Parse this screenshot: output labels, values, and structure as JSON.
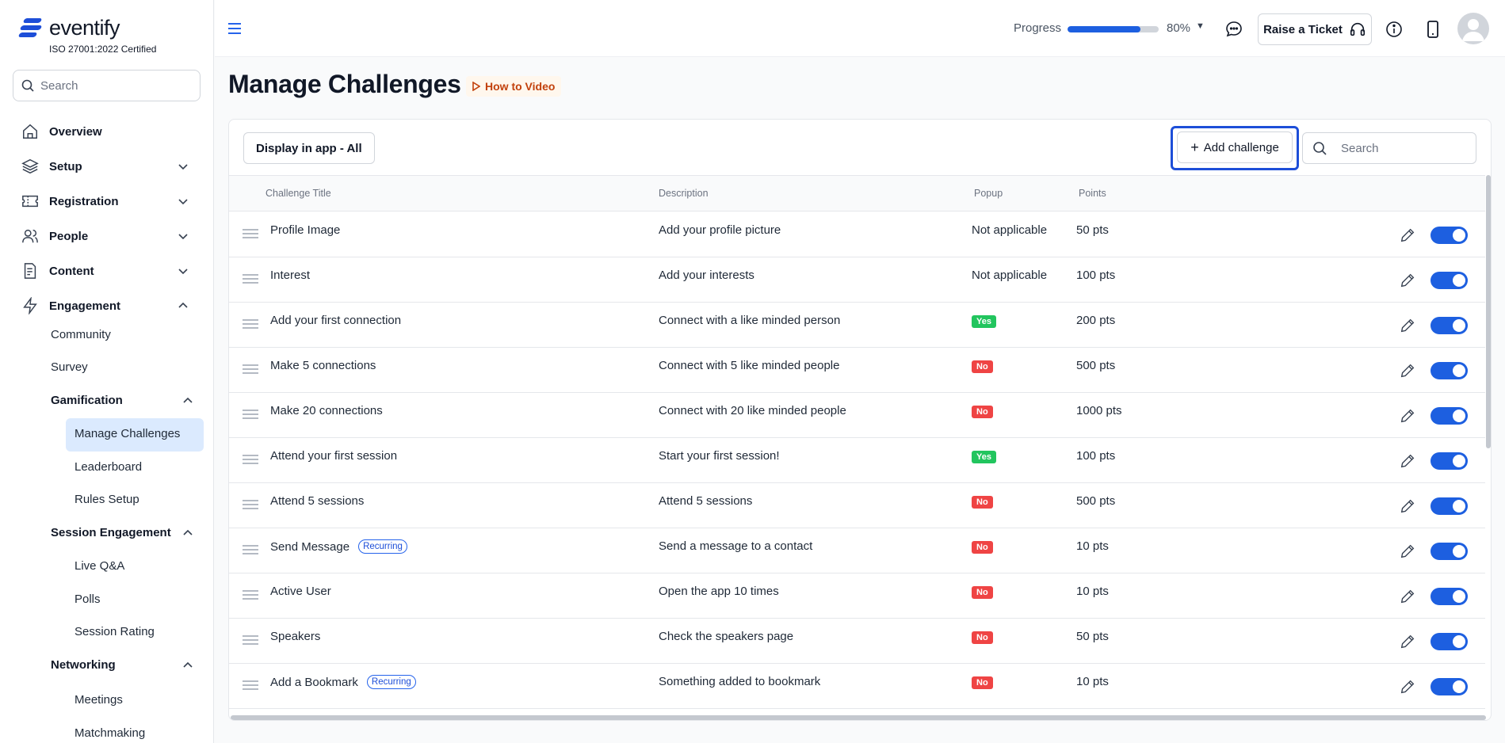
{
  "sidebar": {
    "brand": "eventify",
    "certification": "ISO 27001:2022 Certified",
    "search_placeholder": "Search",
    "nav": [
      {
        "label": "Overview"
      },
      {
        "label": "Setup"
      },
      {
        "label": "Registration"
      },
      {
        "label": "People"
      },
      {
        "label": "Content"
      },
      {
        "label": "Engagement"
      }
    ],
    "engagement_items": [
      "Community",
      "Survey"
    ],
    "gamification": {
      "label": "Gamification",
      "items": [
        "Manage Challenges",
        "Leaderboard",
        "Rules Setup"
      ]
    },
    "session_engagement": {
      "label": "Session Engagement",
      "items": [
        "Live Q&A",
        "Polls",
        "Session Rating"
      ]
    },
    "networking": {
      "label": "Networking",
      "items": [
        "Meetings",
        "Matchmaking"
      ]
    }
  },
  "topbar": {
    "progress_label": "Progress",
    "progress_value": 0.8,
    "progress_pct": "80%",
    "ticket_label": "Raise a Ticket"
  },
  "page": {
    "title": "Manage Challenges",
    "how_to": "How to Video"
  },
  "toolbar": {
    "filter_label": "Display in app - All",
    "add_label": "Add challenge",
    "search_placeholder": "Search"
  },
  "table": {
    "columns": [
      "Challenge Title",
      "Description",
      "Popup",
      "Points"
    ],
    "rows": [
      {
        "title": "Profile Image",
        "recurring": "",
        "description": "Add your profile picture",
        "popup": "Not applicable",
        "points": "50 pts",
        "enabled": true
      },
      {
        "title": "Interest",
        "recurring": "",
        "description": "Add your interests",
        "popup": "Not applicable",
        "points": "100 pts",
        "enabled": true
      },
      {
        "title": "Add your first connection",
        "recurring": "",
        "description": "Connect with a like minded person",
        "popup": "Yes",
        "points": "200 pts",
        "enabled": true
      },
      {
        "title": "Make 5 connections",
        "recurring": "",
        "description": "Connect with 5 like minded people",
        "popup": "No",
        "points": "500 pts",
        "enabled": true
      },
      {
        "title": "Make 20 connections",
        "recurring": "",
        "description": "Connect with 20 like minded people",
        "popup": "No",
        "points": "1000 pts",
        "enabled": true
      },
      {
        "title": "Attend your first session",
        "recurring": "",
        "description": "Start your first session!",
        "popup": "Yes",
        "points": "100 pts",
        "enabled": true
      },
      {
        "title": "Attend 5 sessions",
        "recurring": "",
        "description": "Attend 5 sessions",
        "popup": "No",
        "points": "500 pts",
        "enabled": true
      },
      {
        "title": "Send Message",
        "recurring": "Recurring",
        "description": "Send a message to a contact",
        "popup": "No",
        "points": "10 pts",
        "enabled": true
      },
      {
        "title": "Active User",
        "recurring": "",
        "description": "Open the app 10 times",
        "popup": "No",
        "points": "10 pts",
        "enabled": true
      },
      {
        "title": "Speakers",
        "recurring": "",
        "description": "Check the speakers page",
        "popup": "No",
        "points": "50 pts",
        "enabled": true
      },
      {
        "title": "Add a Bookmark",
        "recurring": "Recurring",
        "description": "Something added to bookmark",
        "popup": "No",
        "points": "10 pts",
        "enabled": true
      }
    ]
  },
  "colors": {
    "accent": "#1d5fe0",
    "yes": "#22c55e",
    "no": "#ef4444",
    "howto": "#c2410c"
  }
}
